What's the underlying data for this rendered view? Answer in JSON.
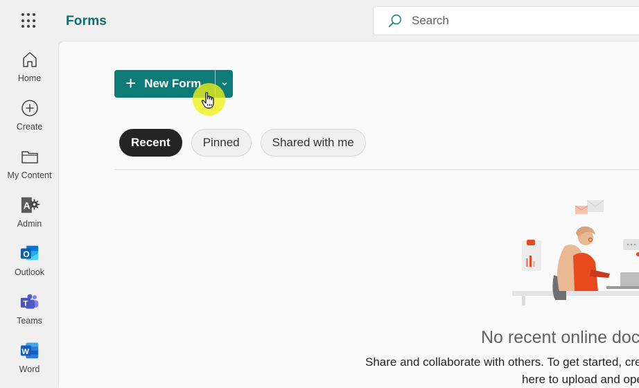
{
  "header": {
    "app_name": "Forms",
    "search_placeholder": "Search"
  },
  "rail": {
    "items": [
      {
        "label": "Home",
        "icon": "home-icon"
      },
      {
        "label": "Create",
        "icon": "create-plus-icon"
      },
      {
        "label": "My Content",
        "icon": "folder-icon"
      },
      {
        "label": "Admin",
        "icon": "admin-icon"
      },
      {
        "label": "Outlook",
        "icon": "outlook-icon"
      },
      {
        "label": "Teams",
        "icon": "teams-icon"
      },
      {
        "label": "Word",
        "icon": "word-icon"
      }
    ]
  },
  "main": {
    "new_button_label": "New Form",
    "tabs": [
      {
        "label": "Recent",
        "active": true
      },
      {
        "label": "Pinned",
        "active": false
      },
      {
        "label": "Shared with me",
        "active": false
      }
    ],
    "empty": {
      "title": "No recent online documents",
      "line1": "Share and collaborate with others. To get started, create a new form or drag it",
      "line2": "here to upload and open."
    }
  },
  "colors": {
    "brand": "#0f7b79",
    "brand_text": "#0f6e6c",
    "active_pill": "#242424",
    "cursor_highlight": "#eef214"
  }
}
